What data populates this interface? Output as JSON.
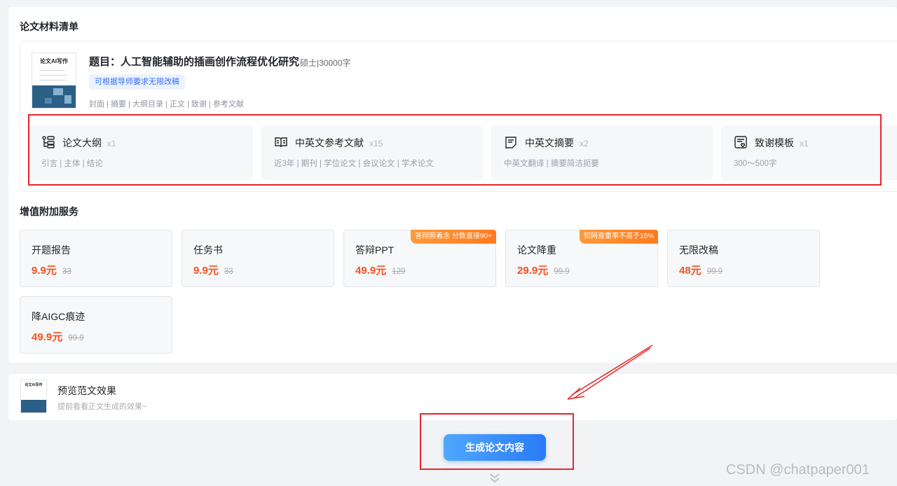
{
  "materials": {
    "section_title": "论文材料清单",
    "cover_title": "论文AI写作",
    "thesis_title": "题目：人工智能辅助的插画创作流程优化研究",
    "thesis_meta": "硕士|30000字",
    "tag": "可根据导师要求无限改稿",
    "parts": "封面 | 摘要 | 大纲目录 | 正文 | 致谢 | 参考文献",
    "features": [
      {
        "name": "论文大纲",
        "count": "x1",
        "desc": "引言 | 主体 | 结论",
        "icon": "outline-icon"
      },
      {
        "name": "中英文参考文献",
        "count": "x15",
        "desc": "近3年 | 期刊 | 学位论文 | 会议论文 | 学术论文",
        "icon": "book-icon"
      },
      {
        "name": "中英文摘要",
        "count": "x2",
        "desc": "中英文翻译 | 摘要简洁扼要",
        "icon": "document-icon"
      },
      {
        "name": "致谢模板",
        "count": "x1",
        "desc": "300～500字",
        "icon": "heart-note-icon"
      }
    ]
  },
  "services": {
    "section_title": "增值附加服务",
    "items": [
      {
        "name": "开题报告",
        "price": "9.9元",
        "original": "33",
        "badge": ""
      },
      {
        "name": "任务书",
        "price": "9.9元",
        "original": "33",
        "badge": ""
      },
      {
        "name": "答辩PPT",
        "price": "49.9元",
        "original": "129",
        "badge": "答辩照着念 分数直接90+"
      },
      {
        "name": "论文降重",
        "price": "29.9元",
        "original": "99.9",
        "badge": "知网查重率不高于15%"
      },
      {
        "name": "无限改稿",
        "price": "48元",
        "original": "99.9",
        "badge": ""
      },
      {
        "name": "降AIGC痕迹",
        "price": "49.9元",
        "original": "99.9",
        "badge": ""
      }
    ]
  },
  "preview": {
    "thumb_title": "论文AI写作",
    "title": "预览范文效果",
    "subtitle": "提前看看正文生成的效果~"
  },
  "generate_button": "生成论文内容",
  "watermark": "CSDN @chatpaper001",
  "colors": {
    "accent": "#3370ff",
    "price": "#f5501e",
    "badge": "#ff8a2a",
    "annotation": "#e8252a"
  }
}
